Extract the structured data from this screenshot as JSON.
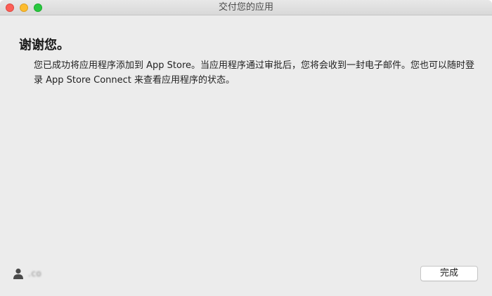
{
  "window": {
    "title": "交付您的应用",
    "controls": [
      "close",
      "minimize",
      "zoom"
    ]
  },
  "content": {
    "heading": "谢谢您。",
    "message": "您已成功将应用程序添加到 App Store。当应用程序通过审批后，您将会收到一封电子邮件。您也可以随时登录 App Store Connect 来查看应用程序的状态。"
  },
  "footer": {
    "account_icon": "person-icon",
    "account_text": ".co",
    "done_label": "完成"
  },
  "colors": {
    "close": "#fc5f57",
    "minimize": "#fdbc2e",
    "zoom": "#29c840",
    "background": "#ececec"
  }
}
